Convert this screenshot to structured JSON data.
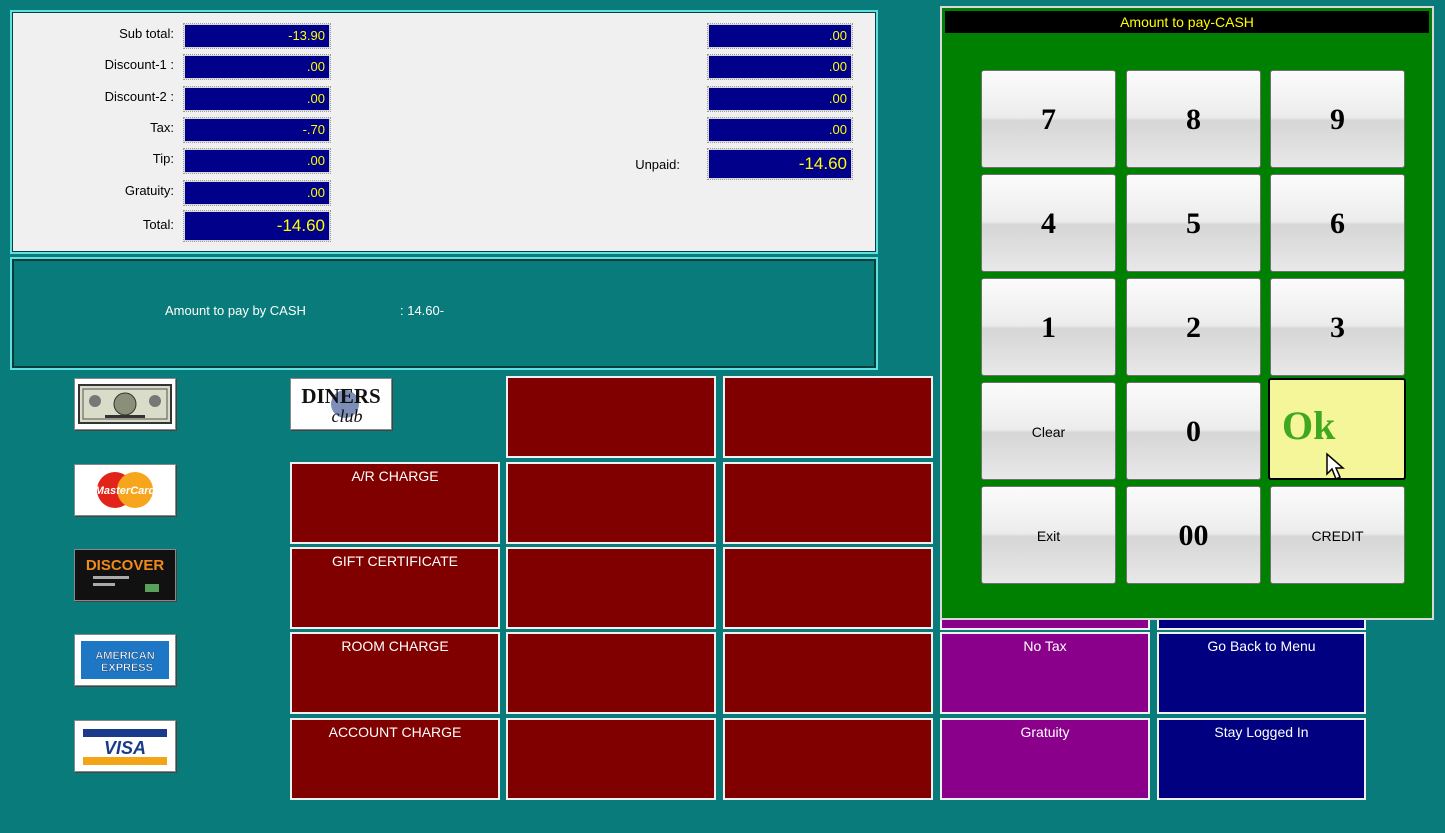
{
  "totals": {
    "labels": [
      "Sub total:",
      "Discount-1  :",
      "Discount-2  :",
      "Tax:",
      "Tip:",
      "Gratuity:",
      "Total:"
    ],
    "values": [
      "-13.90",
      ".00",
      ".00",
      "-.70",
      ".00",
      ".00",
      "-14.60"
    ],
    "right_values": [
      ".00",
      ".00",
      ".00",
      ".00"
    ],
    "unpaid_label": "Unpaid:",
    "unpaid_value": "-14.60"
  },
  "message": {
    "label": "Amount to pay by CASH",
    "value": ":  14.60-"
  },
  "cards": {
    "cash": "cash-bill-icon",
    "diners": "DINERS club",
    "mastercard": "MasterCard",
    "discover": "DISCOVER",
    "amex": "AMERICAN EXPRESS",
    "visa": "VISA"
  },
  "payment_buttons": [
    "A/R CHARGE",
    "GIFT CERTIFICATE",
    "ROOM CHARGE",
    "ACCOUNT CHARGE"
  ],
  "function_buttons": {
    "no_tax": "No Tax",
    "gratuity": "Gratuity",
    "go_back": "Go Back to Menu",
    "stay_logged_in": "Stay Logged In"
  },
  "keypad": {
    "title": "Amount to pay-CASH",
    "keys": [
      "7",
      "8",
      "9",
      "4",
      "5",
      "6",
      "1",
      "2",
      "3",
      "Clear",
      "0",
      "Ok",
      "Exit",
      "00",
      "CREDIT"
    ]
  },
  "colors": {
    "background": "#0a7b7b",
    "payment_button": "#800000",
    "function_purple": "#8b008b",
    "function_navy": "#000080",
    "keypad_bg": "#008000",
    "ok_button": "#f5f59a"
  }
}
